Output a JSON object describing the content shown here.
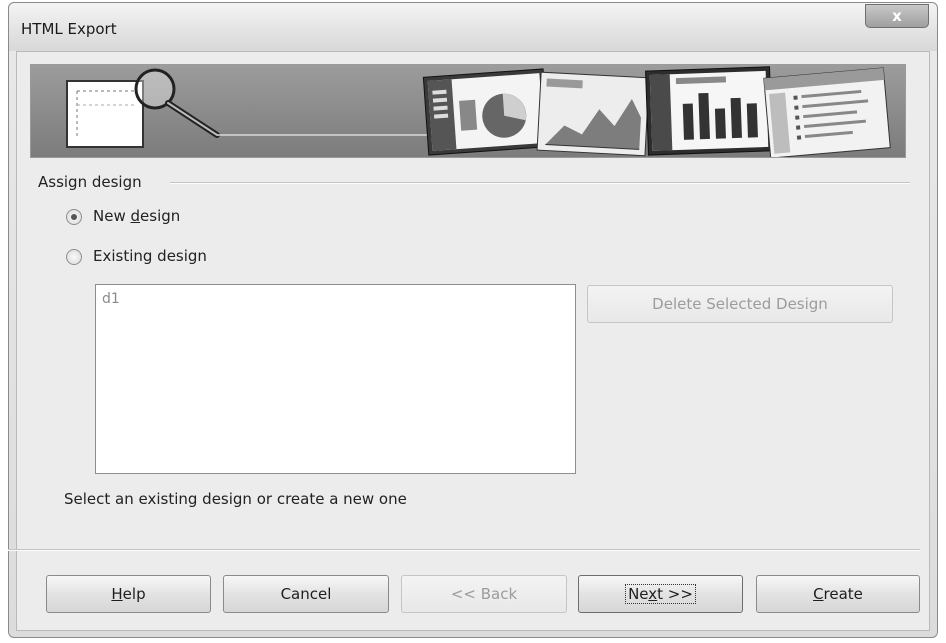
{
  "window": {
    "title": "HTML Export",
    "close_symbol": "x"
  },
  "assign_design": {
    "group_label": "Assign design",
    "new_design_label": "New design",
    "existing_design_label": "Existing design",
    "selected": "new_design",
    "designs": [
      "d1"
    ],
    "delete_button": "Delete Selected Design",
    "hint": "Select an existing design or create a new one"
  },
  "buttons": {
    "help": "Help",
    "cancel": "Cancel",
    "back": "<< Back",
    "next": "Next >>",
    "create": "Create"
  },
  "banner": {
    "icons": [
      "magnifier-icon",
      "pie-chart-slide-icon",
      "area-chart-slide-icon",
      "bar-chart-slide-icon",
      "bullet-list-slide-icon"
    ]
  }
}
